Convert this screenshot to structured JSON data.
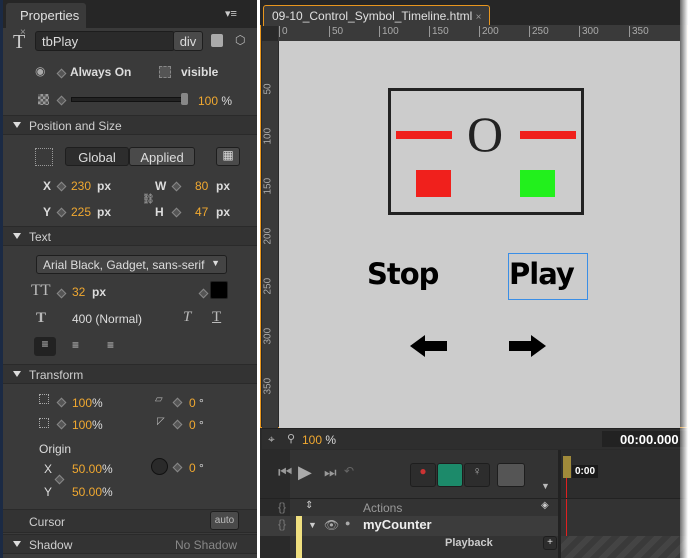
{
  "properties": {
    "panel_title": "Properties",
    "element_name": "tbPlay",
    "tag": "div",
    "display": "Always On",
    "overflow": "visible",
    "opacity": "100",
    "opacity_unit": "%",
    "sections": {
      "position": "Position and Size",
      "text": "Text",
      "transform": "Transform",
      "cursor": "Cursor",
      "shadow": "Shadow"
    },
    "coord_global": "Global",
    "coord_applied": "Applied",
    "x": "230",
    "y": "225",
    "w": "80",
    "h": "47",
    "unit": "px",
    "font_family": "Arial Black, Gadget, sans-serif",
    "font_size": "32",
    "font_weight": "400 (Normal)",
    "text_color": "#000000",
    "scale_x": "100",
    "scale_y": "100",
    "skew_x": "0",
    "skew_y": "0",
    "origin_label": "Origin",
    "origin_x": "50.00",
    "origin_y": "50.00",
    "rotate": "0",
    "deg": "°",
    "pct": "%",
    "cursor_value": "auto",
    "shadow_value": "No Shadow"
  },
  "document": {
    "tab": "09-10_Control_Symbol_Timeline.html",
    "ruler_x": [
      "0",
      "50",
      "100",
      "150",
      "200",
      "250",
      "300",
      "350"
    ],
    "ruler_y": [
      "50",
      "100",
      "150",
      "200",
      "250",
      "300",
      "350",
      "400"
    ],
    "zoom": "100",
    "zoom_unit": "%",
    "time": "00:00.000"
  },
  "stage": {
    "counter_digit": "O",
    "stop_label": "Stop",
    "play_label": "Play",
    "colors": {
      "red": "#f0201c",
      "green": "#22f01c",
      "stage": "#cccccc"
    }
  },
  "timeline": {
    "playhead_time": "0:00",
    "actions_label": "Actions",
    "symbol_name": "myCounter",
    "playback_label": "Playback"
  }
}
